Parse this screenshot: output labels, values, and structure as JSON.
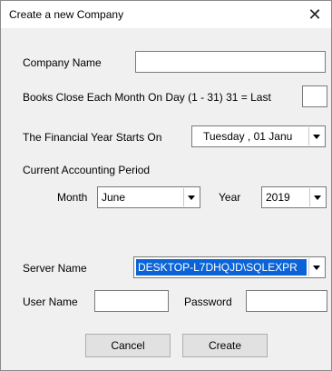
{
  "window": {
    "title": "Create a new Company",
    "close_glyph": "✕"
  },
  "form": {
    "company_name_label": "Company Name",
    "company_name_value": "",
    "books_close_label": "Books Close Each Month On Day (1 - 31) 31 = Last",
    "books_close_value": "",
    "fy_start_label": "The Financial Year Starts On",
    "fy_start_value": "Tuesday  , 01  Janu",
    "current_period_label": "Current Accounting Period",
    "month_label": "Month",
    "month_value": "June",
    "year_label": "Year",
    "year_value": "2019",
    "server_name_label": "Server Name",
    "server_name_value": "DESKTOP-L7DHQJD\\SQLEXPR",
    "user_name_label": "User Name",
    "user_name_value": "",
    "password_label": "Password",
    "password_value": ""
  },
  "buttons": {
    "cancel": "Cancel",
    "create": "Create"
  },
  "colors": {
    "selection": "#0a64d8",
    "dialog_bg": "#f0f0f0"
  }
}
